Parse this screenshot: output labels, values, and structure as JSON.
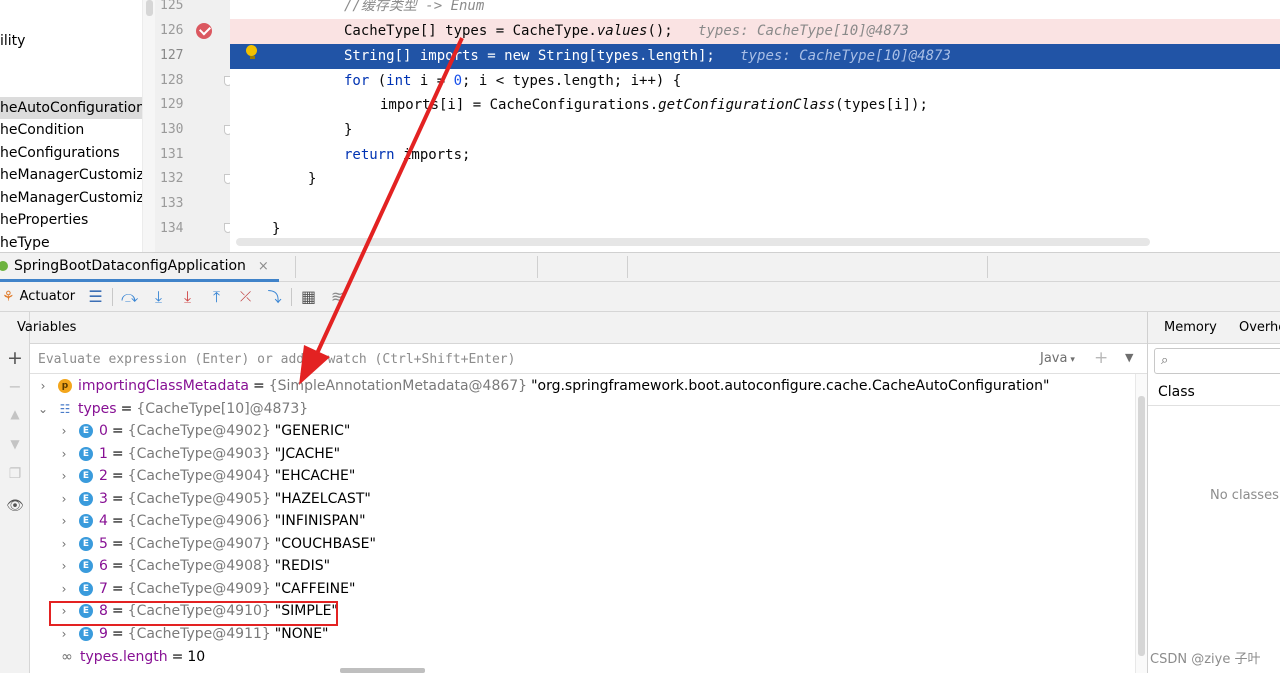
{
  "project_tree": {
    "items": [
      {
        "label": "ility",
        "selected": false
      },
      {
        "label": "heAutoConfiguration",
        "selected": true
      },
      {
        "label": "heCondition",
        "selected": false
      },
      {
        "label": "heConfigurations",
        "selected": false
      },
      {
        "label": "heManagerCustomizer",
        "selected": false
      },
      {
        "label": "heManagerCustomizers",
        "selected": false
      },
      {
        "label": "heProperties",
        "selected": false
      },
      {
        "label": "heType",
        "selected": false
      }
    ]
  },
  "editor": {
    "line_numbers": [
      "125",
      "126",
      "127",
      "128",
      "129",
      "130",
      "131",
      "132",
      "133",
      "134"
    ],
    "breakpoint_line": "126",
    "current_line": "127",
    "lines": {
      "l125_comment": "//缓存类型 -> Enum",
      "l126_a": "CacheType[] types = CacheType.",
      "l126_method": "values",
      "l126_b": "();",
      "l126_hint": "types: CacheType[10]@4873",
      "l127_code": "String[] imports = new String[types.length];",
      "l127_hint": "types: CacheType[10]@4873",
      "l128_for": "for",
      "l128_a": " (",
      "l128_int": "int",
      "l128_b": " i = ",
      "l128_zero": "0",
      "l128_c": "; i < types.length; i++) {",
      "l129_a": "imports[i] = CacheConfigurations.",
      "l129_method": "getConfigurationClass",
      "l129_b": "(types[i]);",
      "l130": "}",
      "l131_return": "return",
      "l131_rest": " imports;",
      "l132": "}",
      "l134": "}"
    }
  },
  "debug_tabbar": {
    "session_label": "SpringBootDataconfigApplication",
    "close_glyph": "×"
  },
  "debug_toolbar": {
    "actuator_label": "Actuator",
    "icons": [
      "actuator-icon",
      "threads-menu-icon",
      "show-execution-point-icon",
      "step-over-icon",
      "step-into-icon",
      "force-step-into-icon",
      "step-out-icon",
      "drop-frame-icon",
      "run-to-cursor-icon",
      "evaluate-icon",
      "trace-icon"
    ]
  },
  "variables": {
    "title": "Variables",
    "eval_placeholder": "Evaluate expression (Enter) or add a watch (Ctrl+Shift+Enter)",
    "eval_language": "Java",
    "rows": [
      {
        "name": "importingClassMetadata",
        "type": "{SimpleAnnotationMetadata@4867}",
        "value": "\"org.springframework.boot.autoconfigure.cache.CacheAutoConfiguration\"",
        "badge": "p",
        "expanded": false
      },
      {
        "name": "types",
        "type": "{CacheType[10]@4873}",
        "value": "",
        "badge": "array",
        "expanded": true
      },
      {
        "name": "0",
        "type": "{CacheType@4902}",
        "value": "\"GENERIC\"",
        "badge": "E"
      },
      {
        "name": "1",
        "type": "{CacheType@4903}",
        "value": "\"JCACHE\"",
        "badge": "E"
      },
      {
        "name": "2",
        "type": "{CacheType@4904}",
        "value": "\"EHCACHE\"",
        "badge": "E"
      },
      {
        "name": "3",
        "type": "{CacheType@4905}",
        "value": "\"HAZELCAST\"",
        "badge": "E"
      },
      {
        "name": "4",
        "type": "{CacheType@4906}",
        "value": "\"INFINISPAN\"",
        "badge": "E"
      },
      {
        "name": "5",
        "type": "{CacheType@4907}",
        "value": "\"COUCHBASE\"",
        "badge": "E"
      },
      {
        "name": "6",
        "type": "{CacheType@4908}",
        "value": "\"REDIS\"",
        "badge": "E"
      },
      {
        "name": "7",
        "type": "{CacheType@4909}",
        "value": "\"CAFFEINE\"",
        "badge": "E"
      },
      {
        "name": "8",
        "type": "{CacheType@4910}",
        "value": "\"SIMPLE\"",
        "badge": "E",
        "highlighted": true
      },
      {
        "name": "9",
        "type": "{CacheType@4911}",
        "value": "\"NONE\"",
        "badge": "E"
      },
      {
        "name": "types.length",
        "type": "",
        "value": "10",
        "badge": "watch"
      }
    ]
  },
  "memory": {
    "tab_memory": "Memory",
    "tab_overhead": "Overhe",
    "column_class": "Class",
    "empty_text": "No classes"
  },
  "watermark": "CSDN @ziye 子叶",
  "colors": {
    "exec_line": "#2154a6",
    "breakpoint_line": "#fae3e3",
    "annotation_red": "#e32222"
  }
}
